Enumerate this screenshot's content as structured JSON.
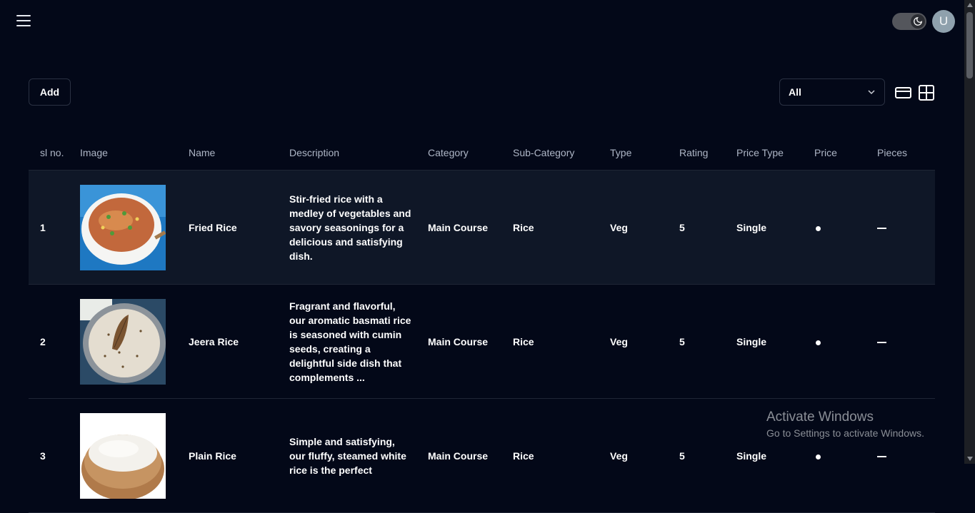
{
  "header": {
    "menu_icon": "hamburger-menu-icon",
    "theme_icon": "moon-icon",
    "avatar_initial": "U"
  },
  "toolbar": {
    "add_label": "Add",
    "filter_value": "All",
    "view_icons": [
      "card-view-icon",
      "grid-view-icon"
    ]
  },
  "table": {
    "columns": [
      "sl no.",
      "Image",
      "Name",
      "Description",
      "Category",
      "Sub-Category",
      "Type",
      "Rating",
      "Price Type",
      "Price",
      "Pieces"
    ],
    "rows": [
      {
        "sl": "1",
        "image": "fried-rice-image",
        "name": "Fried Rice",
        "description": "Stir-fried rice with a medley of vegetables and savory seasonings for a delicious and satisfying dish.",
        "category": "Main Course",
        "sub_category": "Rice",
        "type": "Veg",
        "rating": "5",
        "price_type": "Single"
      },
      {
        "sl": "2",
        "image": "jeera-rice-image",
        "name": "Jeera Rice",
        "description": "Fragrant and flavorful, our aromatic basmati rice is seasoned with cumin seeds, creating a delightful side dish that complements ...",
        "category": "Main Course",
        "sub_category": "Rice",
        "type": "Veg",
        "rating": "5",
        "price_type": "Single"
      },
      {
        "sl": "3",
        "image": "plain-rice-image",
        "name": "Plain Rice",
        "description": "Simple and satisfying, our fluffy, steamed white rice is the perfect",
        "category": "Main Course",
        "sub_category": "Rice",
        "type": "Veg",
        "rating": "5",
        "price_type": "Single"
      }
    ]
  },
  "watermark": {
    "title": "Activate Windows",
    "subtitle": "Go to Settings to activate Windows."
  },
  "colors": {
    "background": "#030818",
    "row_highlight": "#0f1727",
    "border": "#2a3142"
  }
}
